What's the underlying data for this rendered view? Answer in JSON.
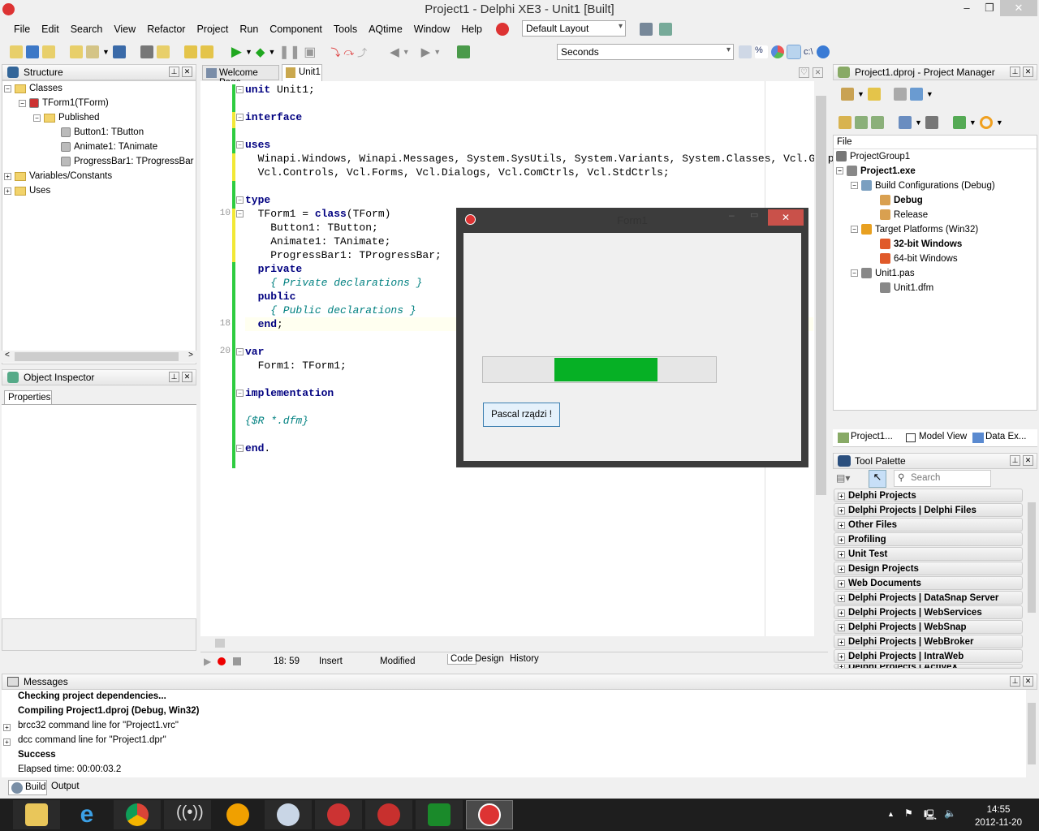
{
  "window": {
    "title": "Project1 - Delphi XE3 - Unit1 [Built]",
    "minimize": "‒",
    "maximize": "❐",
    "close": "✕"
  },
  "menu": [
    "File",
    "Edit",
    "Search",
    "View",
    "Refactor",
    "Project",
    "Run",
    "Component",
    "Tools",
    "AQtime",
    "Window",
    "Help"
  ],
  "toolbar": {
    "layout_combo": "Default Layout",
    "seconds_combo": "Seconds",
    "path_label": "c:\\"
  },
  "structure": {
    "title": "Structure",
    "tree": [
      {
        "label": "Classes"
      },
      {
        "label": "TForm1(TForm)"
      },
      {
        "label": "Published"
      },
      {
        "label": "Button1: TButton"
      },
      {
        "label": "Animate1: TAnimate"
      },
      {
        "label": "ProgressBar1: TProgressBar"
      },
      {
        "label": "Variables/Constants"
      },
      {
        "label": "Uses"
      }
    ]
  },
  "object_inspector": {
    "title": "Object Inspector",
    "tab": "Properties"
  },
  "editor": {
    "tabs": [
      "Welcome Page",
      "Unit1"
    ],
    "line_numbers": [
      "10",
      "18",
      "20"
    ],
    "lines": [
      {
        "kw": "unit",
        "rest": " Unit1;"
      },
      {
        "kw": "interface",
        "rest": ""
      },
      {
        "kw": "uses",
        "rest": ""
      },
      {
        "kw": "",
        "rest": "  Winapi.Windows, Winapi.Messages, System.SysUtils, System.Variants, System.Classes, Vcl.Graphics,"
      },
      {
        "kw": "",
        "rest": "  Vcl.Controls, Vcl.Forms, Vcl.Dialogs, Vcl.ComCtrls, Vcl.StdCtrls;"
      },
      {
        "kw": "type",
        "rest": ""
      },
      {
        "kw": "",
        "rest": "  TForm1 = "
      },
      {
        "kw": "",
        "rest": "    Button1: TButton;"
      },
      {
        "kw": "",
        "rest": "    Animate1: TAnimate;"
      },
      {
        "kw": "",
        "rest": "    ProgressBar1: TProgressBar;"
      },
      {
        "kw": "  private",
        "rest": ""
      },
      {
        "kw": "",
        "rest": "    { Private declarations }"
      },
      {
        "kw": "  public",
        "rest": ""
      },
      {
        "kw": "",
        "rest": "    { Public declarations }"
      },
      {
        "kw": "  end",
        "rest": ";"
      },
      {
        "kw": "var",
        "rest": ""
      },
      {
        "kw": "",
        "rest": "  Form1: TForm1;"
      },
      {
        "kw": "implementation",
        "rest": ""
      },
      {
        "kw": "",
        "rest": "{$R *.dfm}"
      },
      {
        "kw": "end",
        "rest": "."
      }
    ],
    "class_kw": "class",
    "class_rest": "(TForm)",
    "status": {
      "position": "18: 59",
      "mode": "Insert",
      "state": "Modified"
    },
    "view_tabs": [
      "Code",
      "Design",
      "History"
    ]
  },
  "form1": {
    "title": "Form1",
    "progress_percent": 45,
    "button": "Pascal rządzi !",
    "progress_color": "#06b025"
  },
  "project_manager": {
    "title": "Project1.dproj - Project Manager",
    "header": "File",
    "tree": [
      {
        "label": "ProjectGroup1"
      },
      {
        "label": "Project1.exe"
      },
      {
        "label": "Build Configurations (Debug)"
      },
      {
        "label": "Debug"
      },
      {
        "label": "Release"
      },
      {
        "label": "Target Platforms (Win32)"
      },
      {
        "label": "32-bit Windows"
      },
      {
        "label": "64-bit Windows"
      },
      {
        "label": "Unit1.pas"
      },
      {
        "label": "Unit1.dfm"
      }
    ],
    "tabs": [
      "Project1...",
      "Model View",
      "Data Ex..."
    ]
  },
  "tool_palette": {
    "title": "Tool Palette",
    "search_placeholder": "Search",
    "categories": [
      "Delphi Projects",
      "Delphi Projects | Delphi Files",
      "Other Files",
      "Profiling",
      "Unit Test",
      "Design Projects",
      "Web Documents",
      "Delphi Projects | DataSnap Server",
      "Delphi Projects | WebServices",
      "Delphi Projects | WebSnap",
      "Delphi Projects | WebBroker",
      "Delphi Projects | IntraWeb",
      "Delphi Projects | ActiveX"
    ]
  },
  "messages": {
    "title": "Messages",
    "lines": [
      {
        "text": "Checking project dependencies...",
        "bold": true
      },
      {
        "text": "Compiling Project1.dproj (Debug, Win32)",
        "bold": true
      },
      {
        "text": "brcc32 command line for \"Project1.vrc\"",
        "bold": false
      },
      {
        "text": "dcc command line for \"Project1.dpr\"",
        "bold": false
      },
      {
        "text": "Success",
        "bold": true
      },
      {
        "text": "Elapsed time: 00:00:03.2",
        "bold": false
      }
    ],
    "tabs": [
      "Build",
      "Output"
    ]
  },
  "taskbar": {
    "time": "14:55",
    "date": "2012-11-20"
  }
}
